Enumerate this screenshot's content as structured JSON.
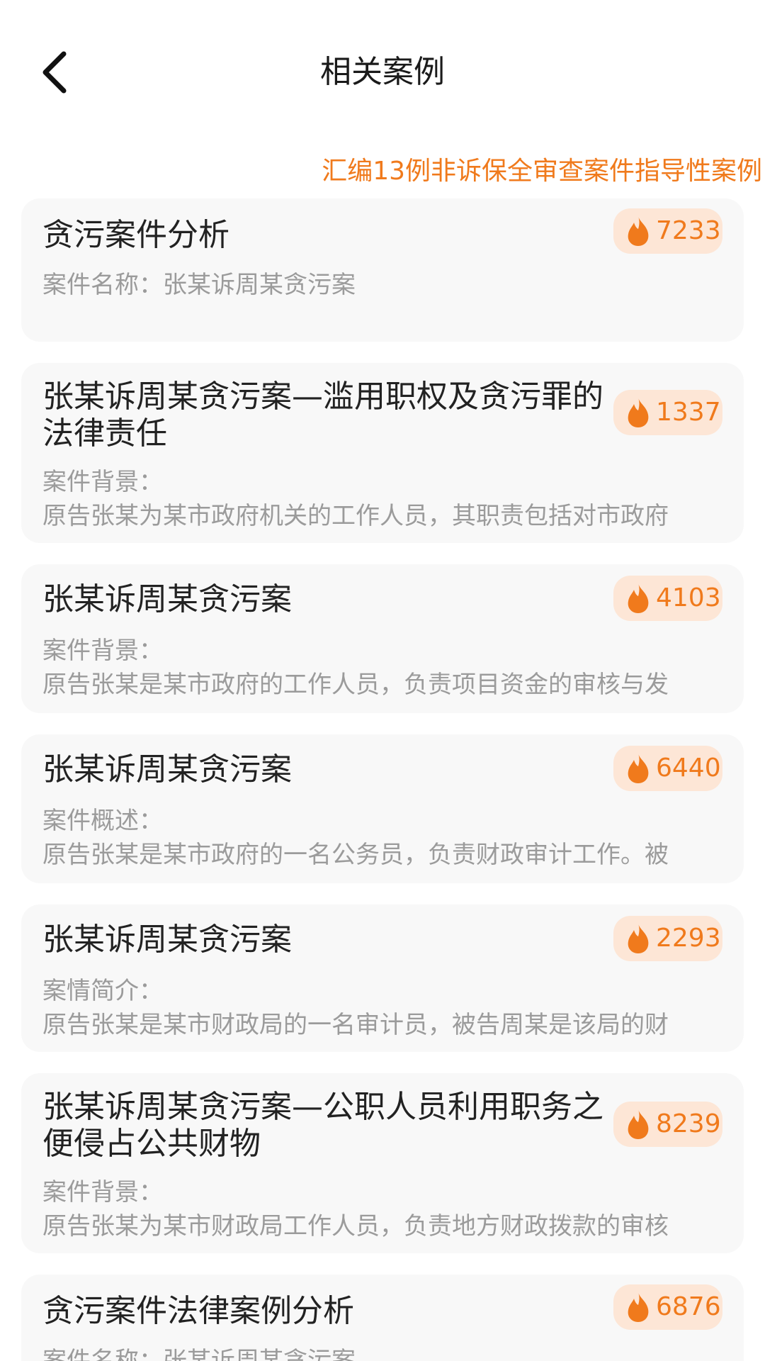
{
  "header": {
    "title": "相关案例"
  },
  "banner": "汇编13例非诉保全审查案件指导性案例",
  "colors": {
    "accent": "#f07a1c",
    "badge_bg": "#fde6d6",
    "card_bg": "#f8f8f8"
  },
  "cards": [
    {
      "title": "贪污案件分析",
      "line1": "案件名称：张某诉周某贪污案",
      "line2": "",
      "hot": "7233"
    },
    {
      "title": "张某诉周某贪污案—滥用职权及贪污罪的法律责任",
      "line1": "案件背景：",
      "line2": "原告张某为某市政府机关的工作人员，其职责包括对市政府",
      "hot": "1337"
    },
    {
      "title": "张某诉周某贪污案",
      "line1": "案件背景：",
      "line2": "原告张某是某市政府的工作人员，负责项目资金的审核与发",
      "hot": "4103"
    },
    {
      "title": "张某诉周某贪污案",
      "line1": "案件概述：",
      "line2": "原告张某是某市政府的一名公务员，负责财政审计工作。被",
      "hot": "6440"
    },
    {
      "title": "张某诉周某贪污案",
      "line1": "案情简介：",
      "line2": "原告张某是某市财政局的一名审计员，被告周某是该局的财",
      "hot": "2293"
    },
    {
      "title": "张某诉周某贪污案—公职人员利用职务之便侵占公共财物",
      "line1": "案件背景：",
      "line2": "原告张某为某市财政局工作人员，负责地方财政拨款的审核",
      "hot": "8239"
    },
    {
      "title": "贪污案件法律案例分析",
      "line1": "案件名称：张某诉周某贪污案",
      "line2": "",
      "hot": "6876"
    }
  ]
}
